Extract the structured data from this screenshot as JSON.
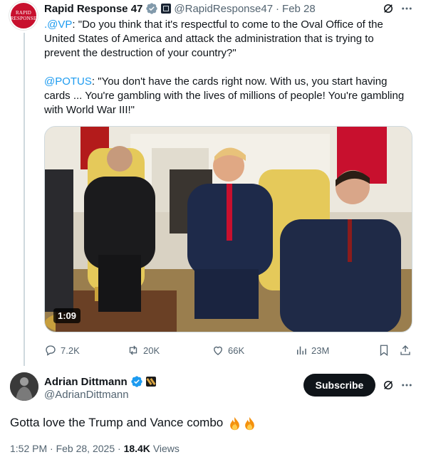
{
  "quoted_post": {
    "avatar_text_line1": "RAPID",
    "avatar_text_line2": "RESPONSE",
    "author_name": "Rapid Response 47",
    "handle": "@RapidResponse47",
    "separator": "·",
    "date": "Feb 28",
    "mention_vp": ".@VP",
    "text_part1": ": \"Do you think that it's respectful to come to the Oval Office of the United States of America and attack the administration that is trying to prevent the destruction of your country?\"",
    "mention_potus": "@POTUS",
    "text_part2": ": \"You don't have the cards right now. With us, you start having cards ... You're gambling with the lives of millions of people! You're gambling with World War III!\"",
    "video_duration": "1:09",
    "stats": {
      "replies": "7.2K",
      "reposts": "20K",
      "likes": "66K",
      "views": "23M"
    }
  },
  "main_post": {
    "author_name": "Adrian Dittmann",
    "handle": "@AdrianDittmann",
    "subscribe_label": "Subscribe",
    "text": "Gotta love the Trump and Vance combo",
    "emoji": "🔥🔥",
    "time": "1:52 PM",
    "separator": "·",
    "date": "Feb 28, 2025",
    "separator2": "·",
    "views_count": "18.4K",
    "views_label": "Views"
  },
  "colors": {
    "accent": "#1d9bf0",
    "text": "#0f1419",
    "muted": "#536471",
    "verified": "#1d9bf0",
    "subscribe_bg": "#0f1419"
  },
  "icons": [
    "verified-badge-icon",
    "affiliate-badge-icon",
    "grok-icon",
    "more-icon",
    "reply-icon",
    "repost-icon",
    "like-icon",
    "views-icon",
    "bookmark-icon",
    "share-icon",
    "fire-emoji"
  ]
}
